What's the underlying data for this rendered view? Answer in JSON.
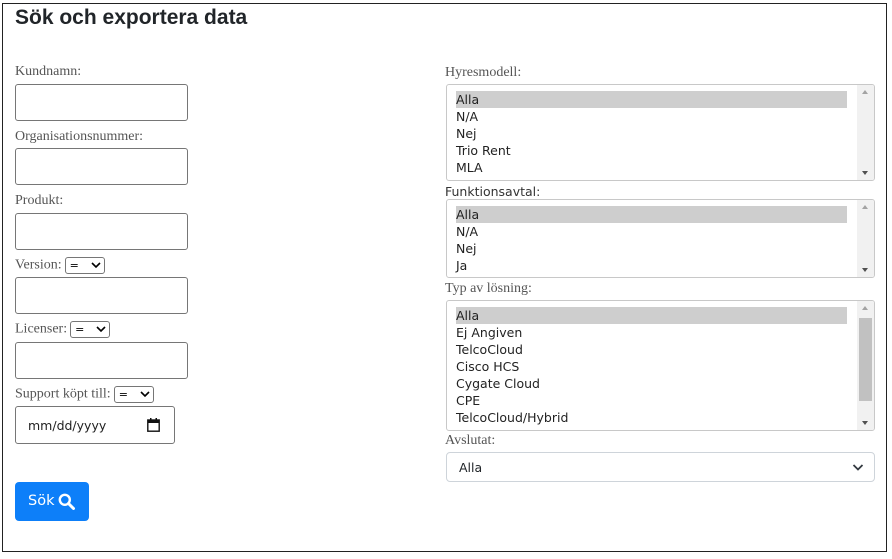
{
  "page": {
    "title": "Sök och exportera data"
  },
  "form": {
    "kundnamn": {
      "label": "Kundnamn:",
      "value": ""
    },
    "orgnr": {
      "label": "Organisationsnummer:",
      "value": ""
    },
    "produkt": {
      "label": "Produkt:",
      "value": ""
    },
    "version": {
      "label": "Version:",
      "operator": "=",
      "value": ""
    },
    "licenser": {
      "label": "Licenser:",
      "operator": "=",
      "value": ""
    },
    "support": {
      "label": "Support köpt till:",
      "operator": "=",
      "date_placeholder": "mm/dd/yyyy"
    },
    "search_button": {
      "label": "Sök",
      "icon": "search-icon"
    }
  },
  "filters": {
    "hyresmodell": {
      "label": "Hyresmodell:",
      "options": [
        "Alla",
        "N/A",
        "Nej",
        "Trio Rent",
        "MLA"
      ],
      "selected": "Alla"
    },
    "funktionsavtal": {
      "label": "Funktionsavtal:",
      "options": [
        "Alla",
        "N/A",
        "Nej",
        "Ja"
      ],
      "selected": "Alla"
    },
    "typ_av_losning": {
      "label": "Typ av lösning:",
      "options": [
        "Alla",
        "Ej Angiven",
        "TelcoCloud",
        "Cisco HCS",
        "Cygate Cloud",
        "CPE",
        "TelcoCloud/Hybrid"
      ],
      "selected": "Alla"
    },
    "avslutat": {
      "label": "Avslutat:",
      "selected": "Alla"
    }
  },
  "colors": {
    "primary_button": "#0d7ff9",
    "selected_option": "#cecece"
  }
}
